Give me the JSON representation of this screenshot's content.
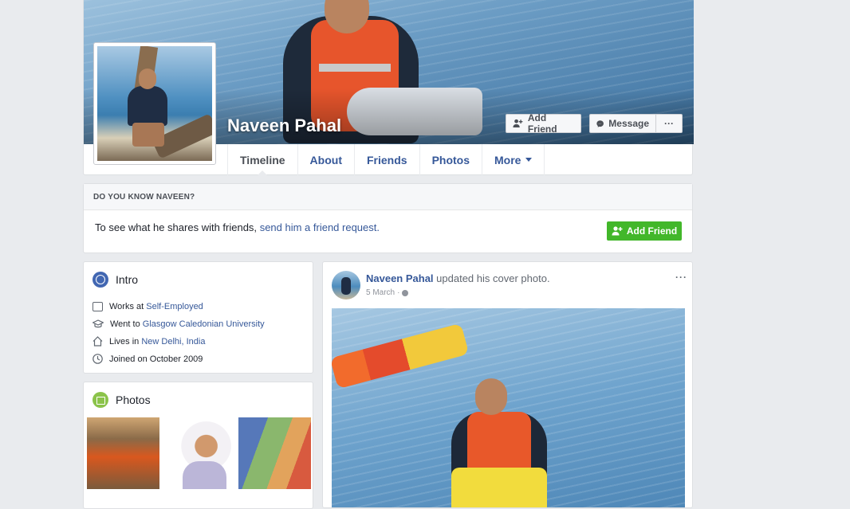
{
  "profile": {
    "name": "Naveen Pahal",
    "buttons": {
      "add_friend": "Add Friend",
      "message": "Message",
      "more": "···"
    }
  },
  "tabs": [
    {
      "label": "Timeline"
    },
    {
      "label": "About"
    },
    {
      "label": "Friends"
    },
    {
      "label": "Photos"
    },
    {
      "label": "More"
    }
  ],
  "know": {
    "heading": "DO YOU KNOW NAVEEN?",
    "text": "To see what he shares with friends,",
    "link": "send him a friend request.",
    "button": "Add Friend"
  },
  "intro": {
    "title": "Intro",
    "rows": [
      {
        "prefix": "Works at",
        "link": "Self-Employed",
        "icon": "briefcase-icon"
      },
      {
        "prefix": "Went to",
        "link": "Glasgow Caledonian University",
        "icon": "graduation-cap-icon"
      },
      {
        "prefix": "Lives in",
        "link": "New Delhi, India",
        "icon": "home-icon"
      },
      {
        "prefix": "Joined on October 2009",
        "link": "",
        "icon": "clock-icon"
      }
    ]
  },
  "photos": {
    "title": "Photos"
  },
  "post": {
    "author": "Naveen Pahal",
    "action": "updated his cover photo.",
    "date": "5 March",
    "separator": "·",
    "menu": "···"
  },
  "colors": {
    "page_bg": "#e9ebee",
    "link": "#365899",
    "green_button": "#42b72a",
    "intro_icon": "#4267b2",
    "photos_icon": "#8bc34a"
  }
}
